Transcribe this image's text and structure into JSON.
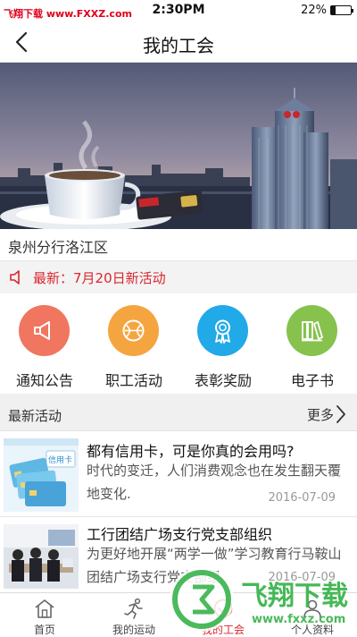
{
  "status": {
    "watermark": "飞翔下载 www.FXXZ.com",
    "time": "2:30PM",
    "battery": "22%",
    "battery_level": 0.22
  },
  "nav": {
    "title": "我的工会",
    "back_icon": "chevron-left-icon"
  },
  "banner": {
    "icon": "city-coffee-banner"
  },
  "branch": {
    "name": "泉州分行洛江区"
  },
  "news": {
    "text": "最新：7月20日新活动",
    "icon": "speaker-icon"
  },
  "categories": [
    {
      "label": "通知公告",
      "icon": "megaphone-icon",
      "color": "#f0765f"
    },
    {
      "label": "职工活动",
      "icon": "ball-icon",
      "color": "#f5a540"
    },
    {
      "label": "表彰奖励",
      "icon": "medal-icon",
      "color": "#22a9e8"
    },
    {
      "label": "电子书",
      "icon": "books-icon",
      "color": "#86c24d"
    }
  ],
  "section": {
    "title": "最新活动",
    "more": "更多"
  },
  "activities": [
    {
      "title": "都有信用卡，可是你真的会用吗?",
      "desc": "时代的变迁，人们消费观念也在发生翻天覆地变化.",
      "date": "2016-07-09",
      "thumb_text": "信用卡"
    },
    {
      "title": "工行团结广场支行党支部组织",
      "desc": "为更好地开展“两学一做”学习教育行马鞍山团结广场支行党支部组",
      "date": "2016-07-09"
    }
  ],
  "tabs": [
    {
      "label": "首页",
      "icon": "home-icon",
      "active": false
    },
    {
      "label": "我的运动",
      "icon": "running-icon",
      "active": false
    },
    {
      "label": "我的工会",
      "icon": "union-icon",
      "active": true
    },
    {
      "label": "个人资料",
      "icon": "profile-icon",
      "active": false
    }
  ],
  "overlay_watermark": {
    "brand": "飞翔下载",
    "url": "www.fxxz.com"
  },
  "colors": {
    "accent": "#d9262d",
    "watermark_green": "#37b24a"
  }
}
